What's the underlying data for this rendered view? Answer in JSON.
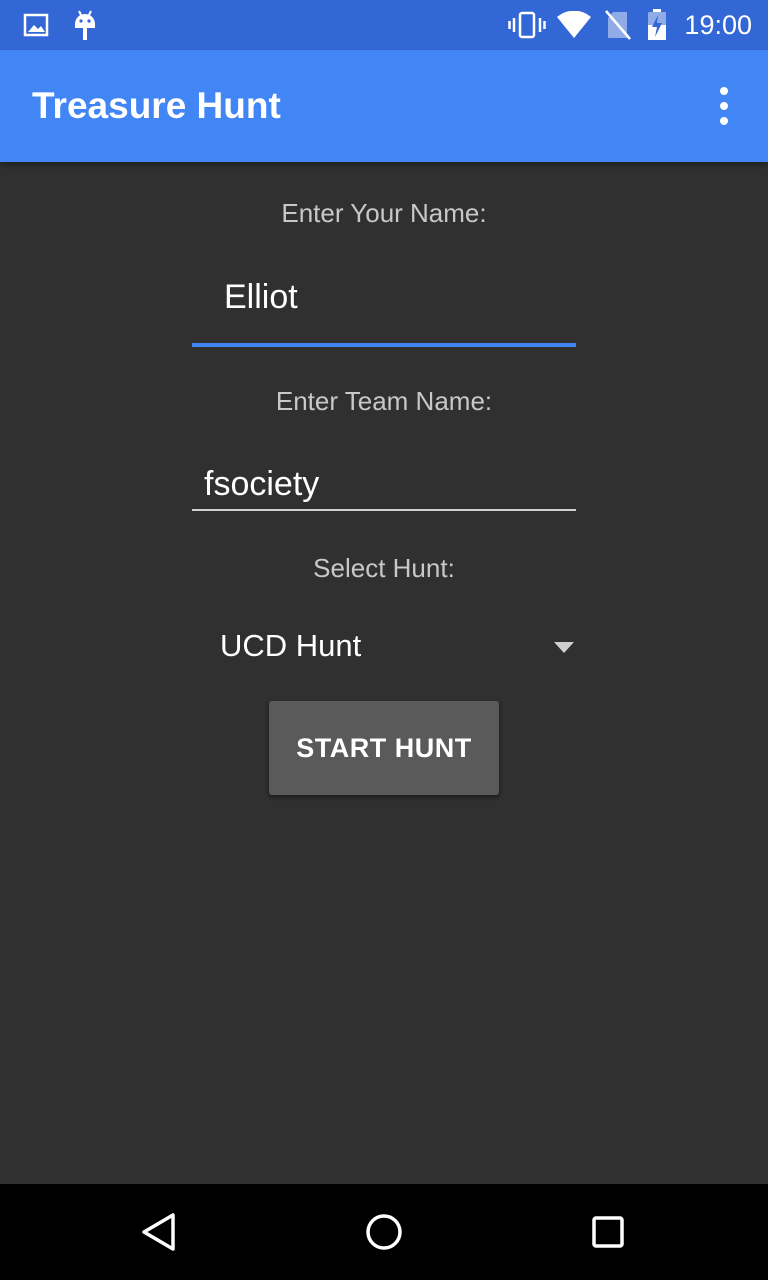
{
  "status_bar": {
    "time": "19:00",
    "icons": [
      "image-icon",
      "android-icon",
      "vibrate-icon",
      "wifi-icon",
      "no-sim-icon",
      "battery-charging-icon"
    ]
  },
  "app_bar": {
    "title": "Treasure Hunt",
    "menu_icon": "overflow-menu-icon"
  },
  "form": {
    "name_label": "Enter Your Name:",
    "name_value": "Elliot",
    "team_label": "Enter Team Name:",
    "team_value": "fsociety",
    "hunt_label": "Select Hunt:",
    "hunt_selected": "UCD Hunt",
    "start_button": "START HUNT"
  },
  "colors": {
    "status_bar": "#3367d6",
    "app_bar": "#4285f4",
    "background": "#303030",
    "focus_underline": "#4285f4",
    "button": "#5a5a5a"
  },
  "nav_bar": {
    "icons": [
      "back-icon",
      "home-icon",
      "recents-icon"
    ]
  }
}
